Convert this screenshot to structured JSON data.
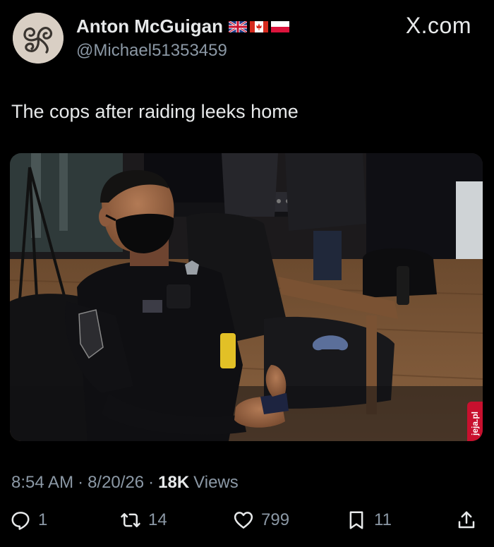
{
  "author": {
    "display_name": "Anton McGuigan",
    "handle": "@Michael51353459",
    "flags": [
      "uk-flag-icon",
      "canada-flag-icon",
      "poland-flag-icon"
    ],
    "avatar": "celtic-triskele-avatar"
  },
  "brand": "X.com",
  "tweet": {
    "text": "The cops after raiding leeks home"
  },
  "media": {
    "watermark": "jeja.pl"
  },
  "meta": {
    "time": "8:54 AM",
    "sep1": "·",
    "date": "8/20/26",
    "sep2": "·",
    "views_count": "18K",
    "views_label": "Views"
  },
  "actions": {
    "replies": "1",
    "reposts": "14",
    "likes": "799",
    "bookmarks": "11"
  },
  "colors": {
    "background": "#000000",
    "text": "#e7e9ea",
    "secondary": "#8b98a5",
    "watermark": "#c8102e"
  }
}
